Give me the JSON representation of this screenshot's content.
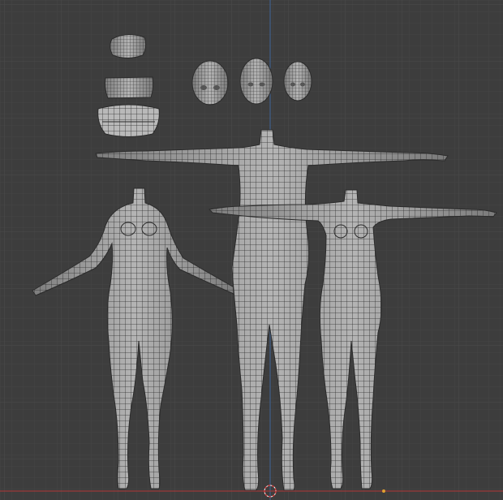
{
  "viewport": {
    "background": "#3d3d3d",
    "grid_minor": "#454545",
    "grid_major": "#4e4e4e",
    "axis_x_color": "#9a3a3a",
    "axis_z_color": "#3f5f8a",
    "mesh_fill": "#9f9f9f",
    "mesh_wire": "#2b2b2b",
    "icons": [
      "3d-cursor-icon",
      "origin-point-icon"
    ]
  },
  "scene_objects": [
    {
      "name": "tongue-mesh"
    },
    {
      "name": "gums-mesh"
    },
    {
      "name": "teeth-mesh"
    },
    {
      "name": "head-mesh-child"
    },
    {
      "name": "head-mesh-male"
    },
    {
      "name": "head-mesh-female"
    },
    {
      "name": "body-mesh-a-pose"
    },
    {
      "name": "body-mesh-t-pose-tall"
    },
    {
      "name": "body-mesh-t-pose-female"
    }
  ]
}
